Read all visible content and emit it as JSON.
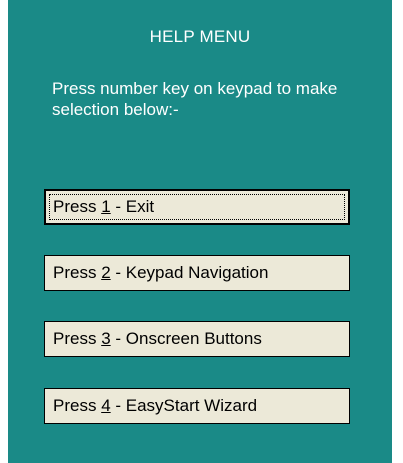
{
  "window": {
    "title": "HELP MENU",
    "instructions": "Press number key on keypad to make selection below:-"
  },
  "colors": {
    "panel_background": "#1a8a87",
    "button_face": "#ece9d8",
    "text_light": "#ffffff",
    "text_dark": "#000000"
  },
  "buttons": [
    {
      "prefix": "Press ",
      "key": "1",
      "label": " - Exit",
      "focused": true
    },
    {
      "prefix": "Press ",
      "key": "2",
      "label": " - Keypad Navigation",
      "focused": false
    },
    {
      "prefix": "Press ",
      "key": "3",
      "label": " - Onscreen Buttons",
      "focused": false
    },
    {
      "prefix": "Press ",
      "key": "4",
      "label": " - EasyStart Wizard",
      "focused": false
    }
  ]
}
